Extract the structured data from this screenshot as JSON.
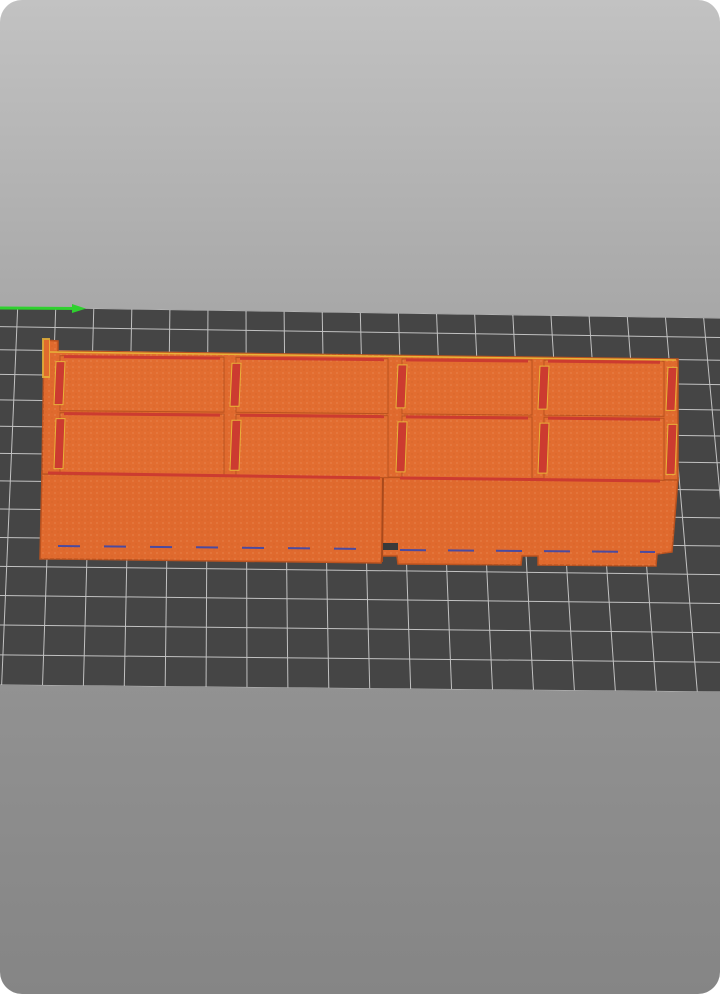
{
  "viewer": {
    "name": "slicer-3d-preview",
    "bed_color": "#454545",
    "grid_color": "#d8d8d8",
    "x_axis_color": "#2fd12f",
    "model_color": "#e06a2e",
    "model_edge_color": "#c85a22",
    "wall_color": "#cc3b30",
    "highlight_color": "#e8b339",
    "seam_color": "#4a4aa0"
  }
}
